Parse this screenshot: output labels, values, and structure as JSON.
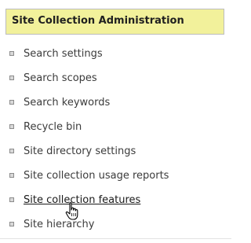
{
  "panel": {
    "title": "Site Collection Administration",
    "links": [
      {
        "label": "Search settings"
      },
      {
        "label": "Search scopes"
      },
      {
        "label": "Search keywords"
      },
      {
        "label": "Recycle bin"
      },
      {
        "label": "Site directory settings"
      },
      {
        "label": "Site collection usage reports"
      },
      {
        "label": "Site collection features",
        "hovered": true
      },
      {
        "label": "Site hierarchy"
      }
    ]
  },
  "colors": {
    "header_bg": "#f2f19b",
    "header_border": "#bcbcbc",
    "link_text": "#3b3b3b"
  },
  "cursor": {
    "icon": "hand-pointer-icon"
  }
}
